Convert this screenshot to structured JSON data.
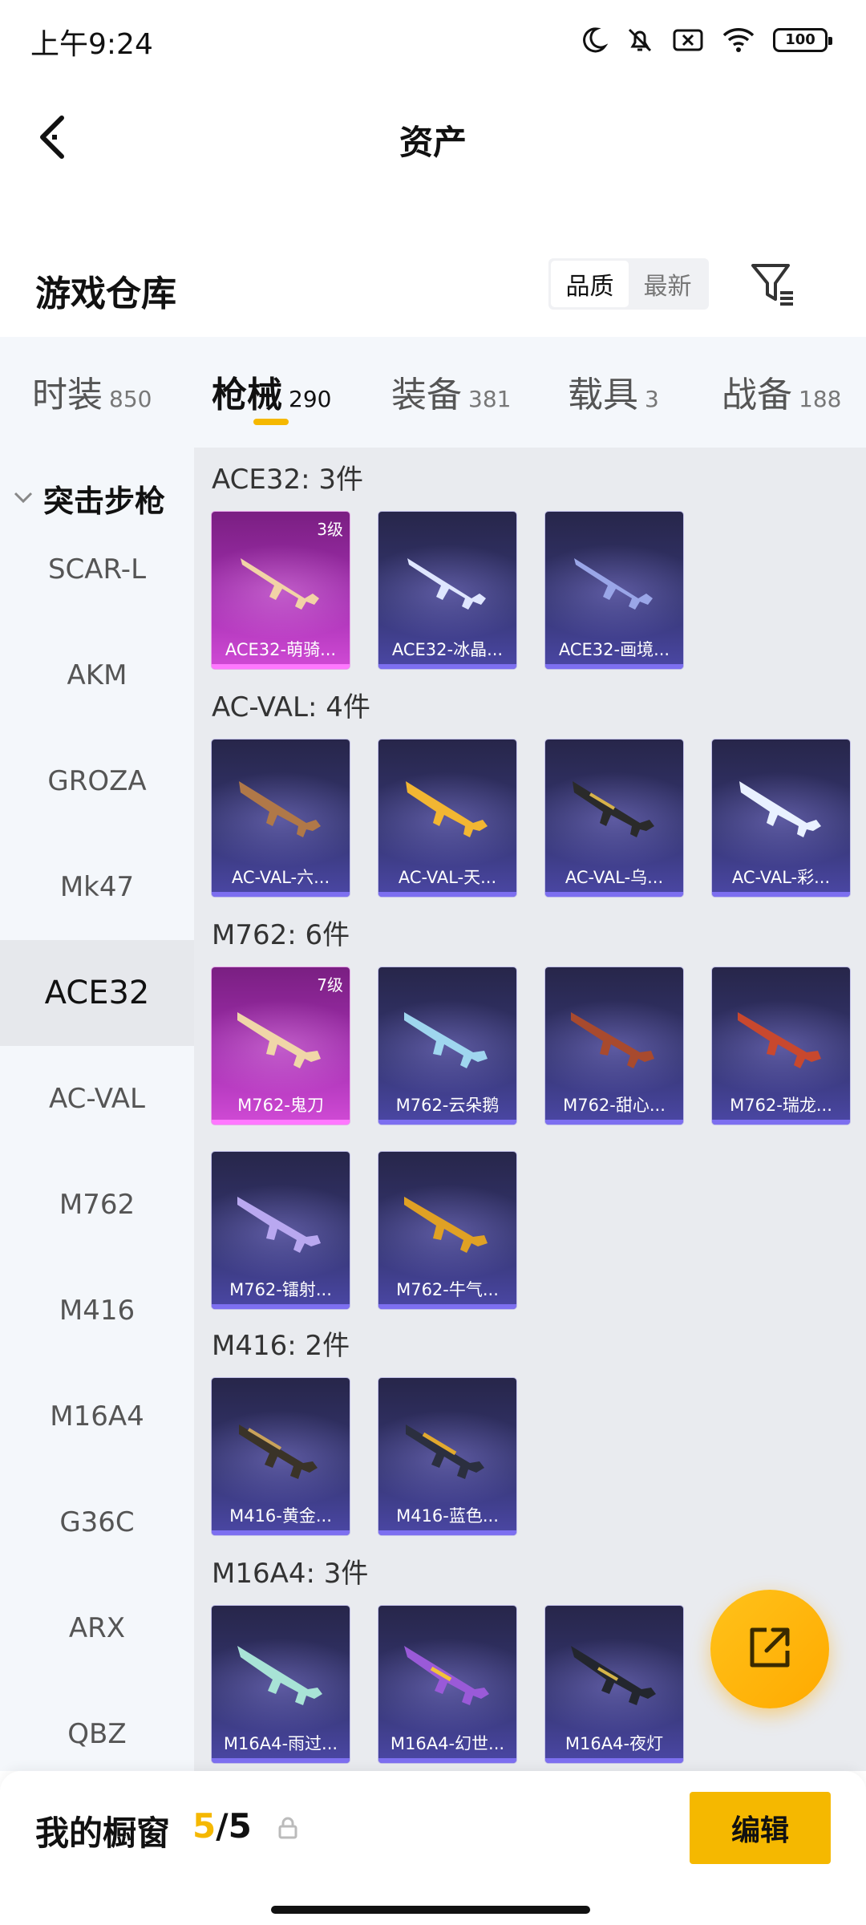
{
  "status_bar": {
    "time": "上午9:24",
    "battery": "100",
    "icons": [
      "moon-icon",
      "mute-bell-icon",
      "sim-off-icon",
      "wifi-icon",
      "battery-icon"
    ]
  },
  "nav": {
    "title": "资产",
    "back_icon": "back-chevron-icon"
  },
  "warehouse": {
    "title": "游戏仓库",
    "sort_options": [
      {
        "label": "品质",
        "active": true
      },
      {
        "label": "最新",
        "active": false
      }
    ],
    "filter_icon": "filter-icon"
  },
  "categories": [
    {
      "label": "时装",
      "count": "850",
      "active": false
    },
    {
      "label": "枪械",
      "count": "290",
      "active": true
    },
    {
      "label": "装备",
      "count": "381",
      "active": false
    },
    {
      "label": "载具",
      "count": "3",
      "active": false
    },
    {
      "label": "战备",
      "count": "188",
      "active": false
    }
  ],
  "sidebar": {
    "group": "突击步枪",
    "items": [
      "SCAR-L",
      "AKM",
      "GROZA",
      "Mk47",
      "ACE32",
      "AC-VAL",
      "M762",
      "M416",
      "M16A4",
      "G36C",
      "ARX",
      "QBZ"
    ],
    "active": "ACE32"
  },
  "sections": [
    {
      "title": "ACE32: 3件",
      "items": [
        {
          "name": "ACE32-萌骑...",
          "quality": "pink",
          "level": "3级"
        },
        {
          "name": "ACE32-冰晶...",
          "quality": "purple",
          "level": ""
        },
        {
          "name": "ACE32-画境...",
          "quality": "purple",
          "level": ""
        }
      ]
    },
    {
      "title": "AC-VAL: 4件",
      "items": [
        {
          "name": "AC-VAL-六...",
          "quality": "purple",
          "level": ""
        },
        {
          "name": "AC-VAL-天...",
          "quality": "purple",
          "level": ""
        },
        {
          "name": "AC-VAL-乌...",
          "quality": "purple",
          "level": ""
        },
        {
          "name": "AC-VAL-彩...",
          "quality": "purple",
          "level": ""
        }
      ]
    },
    {
      "title": "M762: 6件",
      "items": [
        {
          "name": "M762-鬼刀",
          "quality": "pink",
          "level": "7级"
        },
        {
          "name": "M762-云朵鹅",
          "quality": "purple",
          "level": ""
        },
        {
          "name": "M762-甜心...",
          "quality": "purple",
          "level": ""
        },
        {
          "name": "M762-瑞龙...",
          "quality": "purple",
          "level": ""
        },
        {
          "name": "M762-镭射...",
          "quality": "purple",
          "level": ""
        },
        {
          "name": "M762-牛气...",
          "quality": "purple",
          "level": ""
        }
      ]
    },
    {
      "title": "M416: 2件",
      "items": [
        {
          "name": "M416-黄金...",
          "quality": "purple",
          "level": ""
        },
        {
          "name": "M416-蓝色...",
          "quality": "purple",
          "level": ""
        }
      ]
    },
    {
      "title": "M16A4: 3件",
      "items": [
        {
          "name": "M16A4-雨过...",
          "quality": "purple",
          "level": ""
        },
        {
          "name": "M16A4-幻世...",
          "quality": "purple",
          "level": ""
        },
        {
          "name": "M16A4-夜灯",
          "quality": "purple",
          "level": ""
        }
      ]
    }
  ],
  "showcase": {
    "title": "我的橱窗",
    "current": "5",
    "sep_total": "/5",
    "edit_label": "编辑"
  },
  "colors": {
    "accent": "#f5b800",
    "purple_card": "#363775",
    "pink_card": "#a32fb0"
  }
}
